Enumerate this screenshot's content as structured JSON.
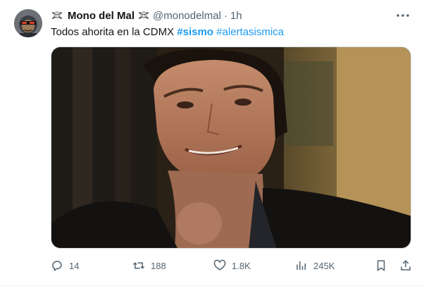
{
  "tweet": {
    "display_name": "Mono del Mal",
    "handle": "@monodelmal",
    "separator": "·",
    "time": "1h",
    "text": "Todos ahorita en la CDMX",
    "hashtags": [
      "#sismo",
      "#alertasismica"
    ],
    "name_emoji_icon": "skull-and-crossbones-icon"
  },
  "actions": {
    "replies": "14",
    "reposts": "188",
    "likes": "1.8K",
    "views": "245K"
  },
  "colors": {
    "text": "#0f1419",
    "secondary": "#536471",
    "link": "#1d9bf0",
    "border": "#cfd9de"
  }
}
